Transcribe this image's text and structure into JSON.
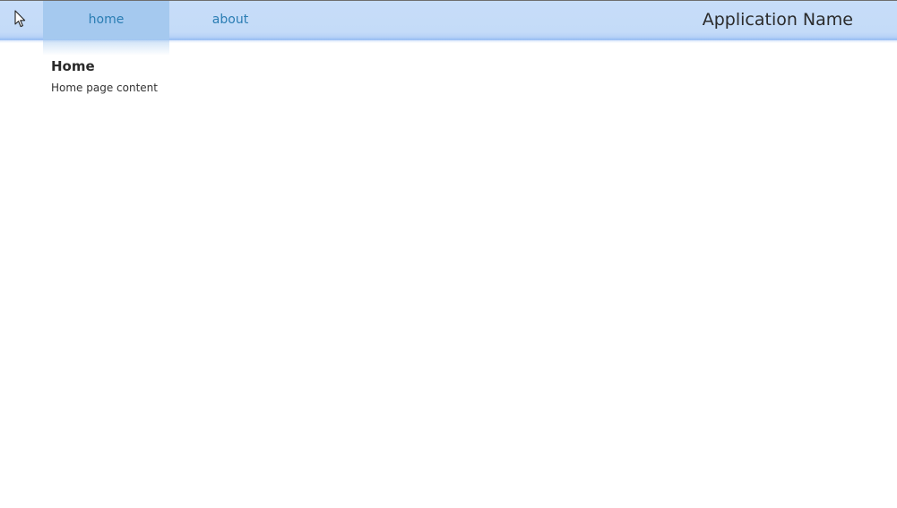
{
  "header": {
    "nav_items": [
      {
        "label": "home",
        "active": true
      },
      {
        "label": "about",
        "active": false
      }
    ],
    "app_name": "Application Name"
  },
  "main": {
    "heading": "Home",
    "body_text": "Home page content"
  },
  "icons": {
    "cursor": "mouse-pointer-icon"
  },
  "colors": {
    "header_background": "#c4dbf8",
    "nav_active_background": "#a5c9ef",
    "nav_link": "#2a7db3",
    "page_background": "#ffffff"
  }
}
